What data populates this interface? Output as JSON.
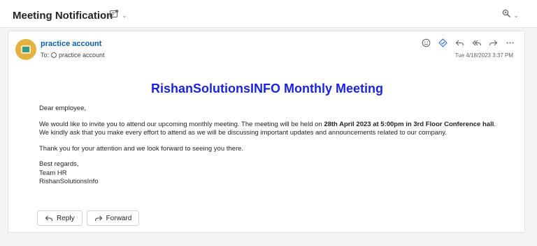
{
  "header": {
    "subject": "Meeting Notification"
  },
  "message": {
    "sender_name": "practice account",
    "to_label": "To:",
    "recipient": "practice account",
    "timestamp": "Tue 4/18/2023 3:37 PM"
  },
  "email": {
    "heading": "RishanSolutionsINFO Monthly Meeting",
    "greeting": "Dear employee,",
    "para1_start": "We would like to invite you to attend our upcoming monthly meeting. The meeting will be held on ",
    "para1_bold": "28th April 2023 at 5:00pm in 3rd Floor Conference hall",
    "para1_end": ". We kindly ask that you make every effort to attend as we will be discussing important updates and announcements related to our company.",
    "para2": "Thank you for your attention and we look forward to seeing you there.",
    "closing": "Best regards,",
    "sign_team": "Team HR",
    "sign_company": "RishanSolutionsInfo"
  },
  "buttons": {
    "reply": "Reply",
    "forward": "Forward"
  },
  "colors": {
    "heading": "#1a24e0",
    "sender": "#0b5ea8",
    "avatar": "#e3b341"
  }
}
